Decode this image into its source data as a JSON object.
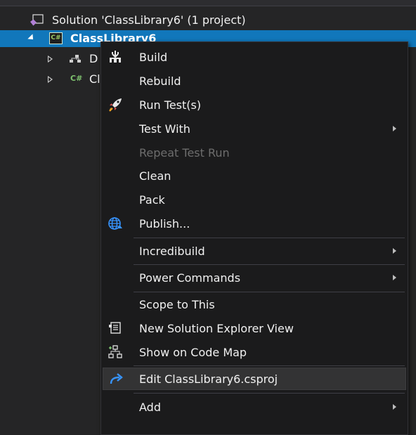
{
  "tree": {
    "solution_label": "Solution 'ClassLibrary6' (1 project)",
    "project_label": "ClassLibrary6",
    "child1_label": "D",
    "child2_label": "Cl",
    "cs_glyph": "C#"
  },
  "menu": {
    "items": [
      {
        "label": "Build",
        "icon": "build-icon"
      },
      {
        "label": "Rebuild"
      },
      {
        "label": "Run Test(s)",
        "icon": "rocket-icon"
      },
      {
        "label": "Test With",
        "submenu": true
      },
      {
        "label": "Repeat Test Run",
        "disabled": true
      },
      {
        "label": "Clean"
      },
      {
        "label": "Pack"
      },
      {
        "label": "Publish...",
        "icon": "globe-publish-icon"
      },
      {
        "label": "Incredibuild",
        "submenu": true
      },
      {
        "label": "Power Commands",
        "submenu": true
      },
      {
        "label": "Scope to This"
      },
      {
        "label": "New Solution Explorer View",
        "icon": "new-view-icon"
      },
      {
        "label": "Show on Code Map",
        "icon": "code-map-icon"
      },
      {
        "label": "Edit ClassLibrary6.csproj",
        "icon": "edit-redo-icon",
        "hovered": true
      },
      {
        "label": "Add",
        "submenu": true
      }
    ]
  },
  "colors": {
    "selection": "#1177bb",
    "menu_bg": "#1b1b1c",
    "accent_blue": "#3794ff",
    "solution_purple": "#b180d7"
  }
}
